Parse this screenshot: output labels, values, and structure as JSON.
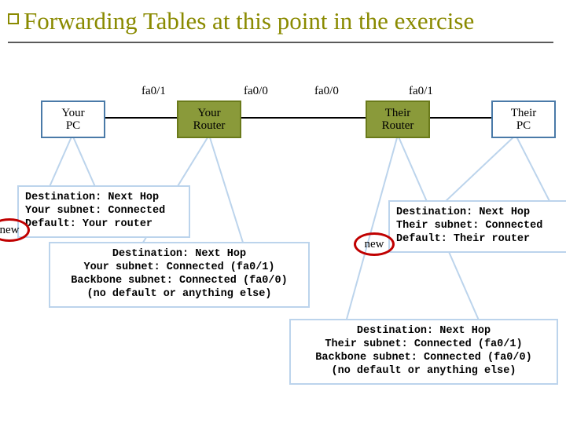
{
  "title": "Forwarding Tables at this point in the exercise",
  "interfaces": {
    "r1_left": "fa0/1",
    "r1_right": "fa0/0",
    "r2_left": "fa0/0",
    "r2_right": "fa0/1"
  },
  "nodes": {
    "your_pc": "Your\nPC",
    "your_router": "Your\nRouter",
    "their_router": "Their\nRouter",
    "their_pc": "Their\nPC"
  },
  "tables": {
    "your_pc": {
      "l1": "Destination: Next Hop",
      "l2": "Your subnet: Connected",
      "l3": "Default: Your router"
    },
    "your_router": {
      "l1": "Destination: Next Hop",
      "l2": "Your subnet: Connected (fa0/1)",
      "l3": "Backbone subnet: Connected (fa0/0)",
      "l4": "(no default or anything else)"
    },
    "their_pc": {
      "l1": "Destination: Next Hop",
      "l2": "Their subnet: Connected",
      "l3": "Default: Their router"
    },
    "their_router": {
      "l1": "Destination: Next Hop",
      "l2": "Their subnet: Connected (fa0/1)",
      "l3": "Backbone subnet: Connected (fa0/0)",
      "l4": "(no default or anything else)"
    }
  },
  "new_label": "new"
}
